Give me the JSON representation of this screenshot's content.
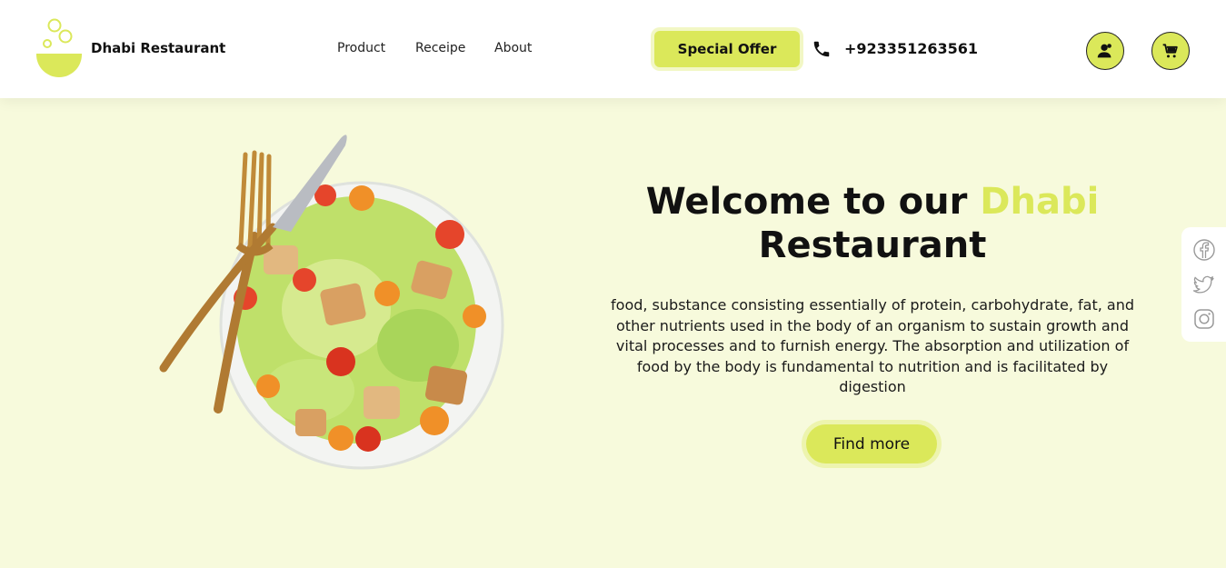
{
  "brand": {
    "name": "Dhabi Restaurant",
    "logo_icon": "bowl-bubbles-logo"
  },
  "nav": {
    "links": [
      "Product",
      "Receipe",
      "About"
    ]
  },
  "header": {
    "offer_label": "Special Offer",
    "phone_icon": "phone-icon",
    "phone": "+923351263561",
    "account_icon": "user-icon",
    "cart_icon": "cart-icon"
  },
  "hero": {
    "title_part1": "Welcome to our",
    "title_accent": "Dhabi",
    "title_part2": "Restaurant",
    "description": "food, substance consisting essentially of protein, carbohydrate, fat, and other nutrients used in the body of an organism to sustain growth and vital processes and to furnish energy. The absorption and utilization of food by the body is fundamental to nutrition and is facilitated by digestion",
    "cta_label": "Find more",
    "image": "salad-plate-with-fork-and-knife"
  },
  "social": {
    "icons": [
      "facebook-icon",
      "twitter-icon",
      "instagram-icon"
    ]
  },
  "colors": {
    "accent": "#dbe85a",
    "background": "#f7fadc",
    "navbar": "#ffffff",
    "text": "#111111"
  }
}
